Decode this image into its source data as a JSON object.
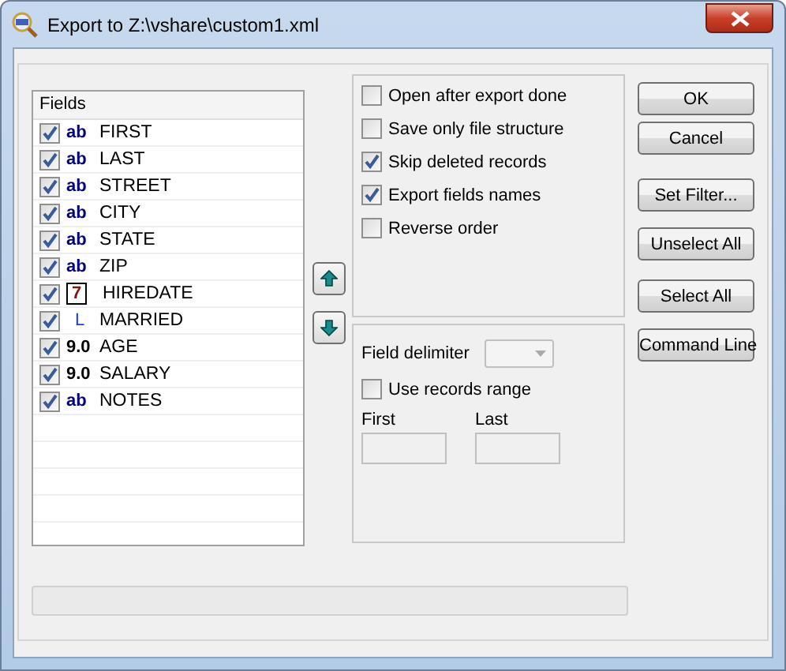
{
  "window": {
    "title": "Export to Z:\\vshare\\custom1.xml"
  },
  "fields_list": {
    "header": "Fields",
    "items": [
      {
        "type_label": "ab",
        "kind": "text",
        "name": "FIRST",
        "checked": true
      },
      {
        "type_label": "ab",
        "kind": "text",
        "name": "LAST",
        "checked": true
      },
      {
        "type_label": "ab",
        "kind": "text",
        "name": "STREET",
        "checked": true
      },
      {
        "type_label": "ab",
        "kind": "text",
        "name": "CITY",
        "checked": true
      },
      {
        "type_label": "ab",
        "kind": "text",
        "name": "STATE",
        "checked": true
      },
      {
        "type_label": "ab",
        "kind": "text",
        "name": "ZIP",
        "checked": true
      },
      {
        "type_label": "7",
        "kind": "date",
        "name": "HIREDATE",
        "checked": true
      },
      {
        "type_label": "L",
        "kind": "logical",
        "name": "MARRIED",
        "checked": true
      },
      {
        "type_label": "9.0",
        "kind": "numeric",
        "name": "AGE",
        "checked": true
      },
      {
        "type_label": "9.0",
        "kind": "numeric",
        "name": "SALARY",
        "checked": true
      },
      {
        "type_label": "ab",
        "kind": "text",
        "name": "NOTES",
        "checked": true
      }
    ]
  },
  "options": [
    {
      "label": "Open after export done",
      "checked": false
    },
    {
      "label": "Save only file structure",
      "checked": false
    },
    {
      "label": "Skip deleted records",
      "checked": true
    },
    {
      "label": "Export fields names",
      "checked": true
    },
    {
      "label": "Reverse order",
      "checked": false
    }
  ],
  "delimiter": {
    "label": "Field delimiter",
    "disabled": true
  },
  "range": {
    "label": "Use records range",
    "checked": false,
    "first_label": "First",
    "last_label": "Last"
  },
  "buttons": [
    "OK",
    "Cancel",
    "Set Filter...",
    "Unselect All",
    "Select All",
    "Command Line"
  ]
}
